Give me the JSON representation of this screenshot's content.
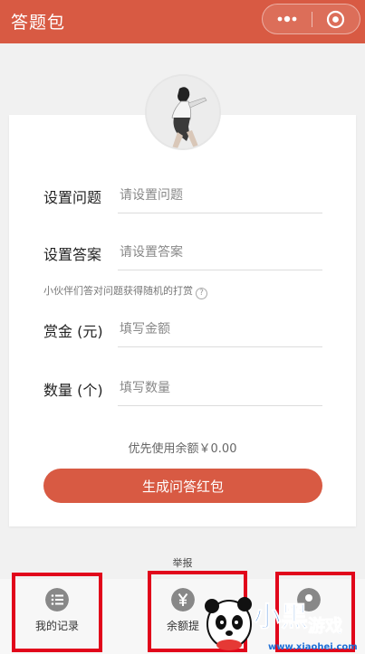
{
  "header": {
    "title": "答题包"
  },
  "form": {
    "question_label": "设置问题",
    "question_placeholder": "请设置问题",
    "answer_label": "设置答案",
    "answer_placeholder": "请设置答案",
    "hint": "小伙伴们答对问题获得随机的打赏",
    "help_glyph": "?",
    "reward_label": "赏金 (元)",
    "reward_placeholder": "填写金额",
    "quantity_label": "数量 (个)",
    "quantity_placeholder": "填写数量",
    "balance_text": "优先使用余额￥0.00",
    "submit_label": "生成问答红包"
  },
  "report_label": "举报",
  "bottom_nav": {
    "records_label": "我的记录",
    "withdraw_label": "余额提",
    "third_label": ""
  },
  "watermark": {
    "text": "小黑游戏",
    "url_text": "www.xiaohei.com"
  },
  "colors": {
    "brand": "#d85a43",
    "highlight_box": "#e1061b"
  },
  "icons": {
    "records": "list-circle-icon",
    "withdraw": "yen-circle-icon",
    "third": "circle-icon"
  }
}
